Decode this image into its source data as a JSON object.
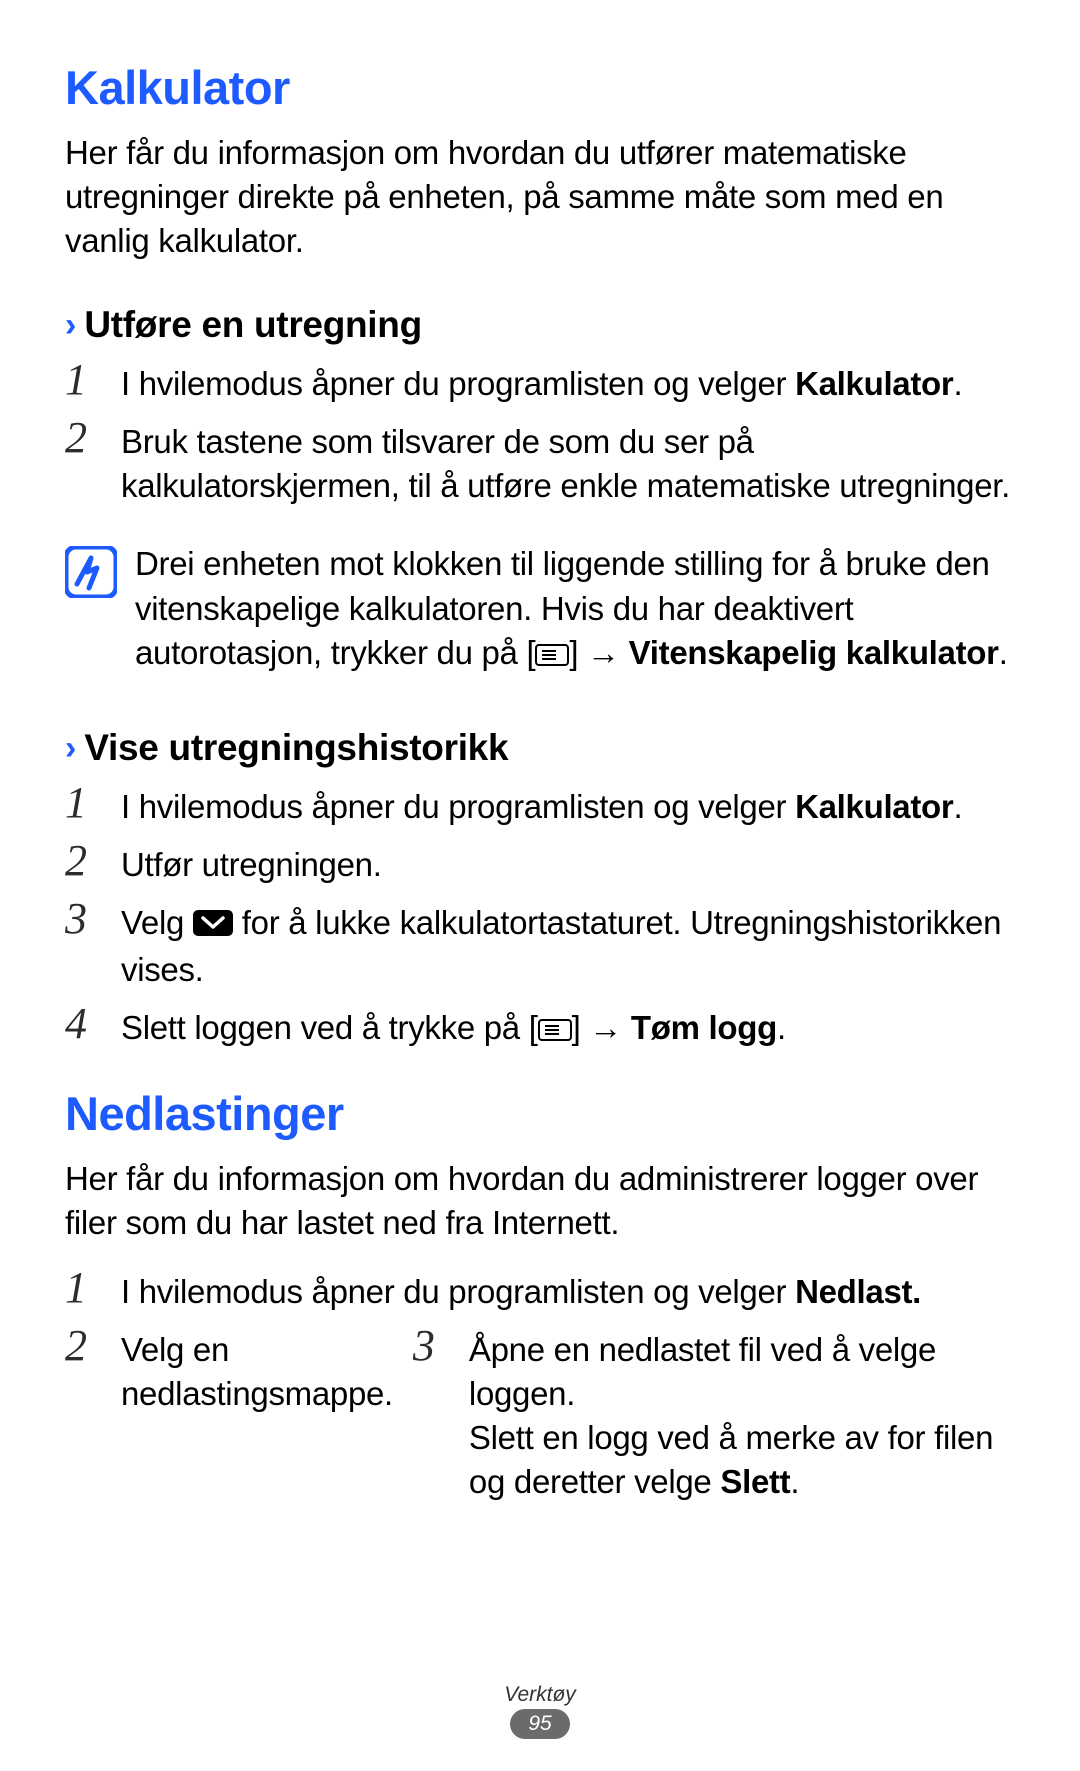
{
  "section1": {
    "title": "Kalkulator",
    "intro": "Her får du informasjon om hvordan du utfører matematiske utregninger direkte på enheten, på samme måte som med en vanlig kalkulator.",
    "sub1": {
      "title": "Utføre en utregning",
      "step1_a": "I hvilemodus åpner du programlisten og velger ",
      "step1_b": "Kalkulator",
      "step1_c": ".",
      "step2": "Bruk tastene som tilsvarer de som du ser på kalkulatorskjermen, til å utføre enkle matematiske utregninger.",
      "note_a": "Drei enheten mot klokken til liggende stilling for å bruke den vitenskapelige kalkulatoren. Hvis du har deaktivert autorotasjon, trykker du på [",
      "note_b": "] → ",
      "note_c": "Vitenskapelig kalkulator",
      "note_d": "."
    },
    "sub2": {
      "title": "Vise utregningshistorikk",
      "step1_a": "I hvilemodus åpner du programlisten og velger ",
      "step1_b": "Kalkulator",
      "step1_c": ".",
      "step2": "Utfør utregningen.",
      "step3_a": "Velg ",
      "step3_b": " for å lukke kalkulatortastaturet. Utregningshistorikken vises.",
      "step4_a": "Slett loggen ved å trykke på [",
      "step4_b": "] → ",
      "step4_c": "Tøm logg",
      "step4_d": "."
    }
  },
  "section2": {
    "title": "Nedlastinger",
    "intro": "Her får du informasjon om hvordan du administrerer logger over filer som du har lastet ned fra Internett.",
    "step1_a": "I hvilemodus åpner du programlisten og velger ",
    "step1_b": "Nedlast.",
    "step2": "Velg en nedlastingsmappe.",
    "step3_a": "Åpne en nedlastet fil ved å velge loggen.",
    "step3_b_a": "Slett en logg ved å merke av for filen og deretter velge ",
    "step3_b_b": "Slett",
    "step3_b_c": "."
  },
  "footer": {
    "category": "Verktøy",
    "page": "95"
  },
  "numbers": {
    "n1": "1",
    "n2": "2",
    "n3": "3",
    "n4": "4"
  },
  "chev": "›"
}
